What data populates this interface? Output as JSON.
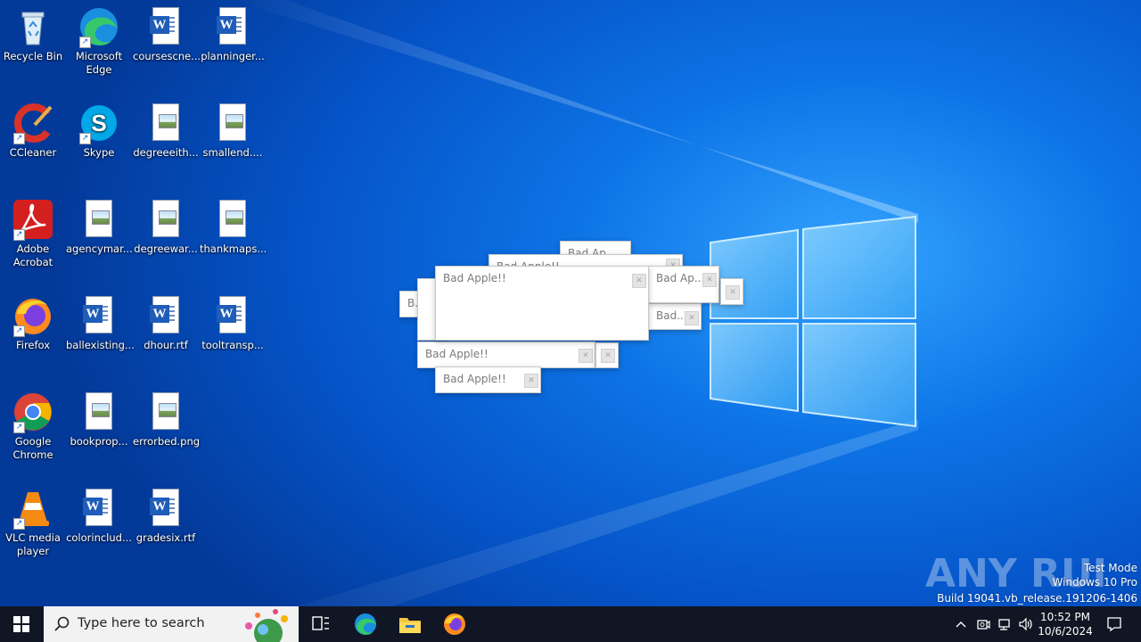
{
  "desktop": {
    "icons": [
      {
        "label": "Recycle Bin",
        "icon": "recycle-bin-icon"
      },
      {
        "label": "Microsoft Edge",
        "icon": "edge-icon"
      },
      {
        "label": "coursescne...",
        "icon": "word-doc-icon"
      },
      {
        "label": "planninger...",
        "icon": "word-doc-icon"
      },
      {
        "label": "CCleaner",
        "icon": "ccleaner-icon"
      },
      {
        "label": "Skype",
        "icon": "skype-icon"
      },
      {
        "label": "degreeeith...",
        "icon": "image-file-icon"
      },
      {
        "label": "smallend....",
        "icon": "image-file-icon"
      },
      {
        "label": "Adobe Acrobat",
        "icon": "acrobat-icon"
      },
      {
        "label": "agencymar...",
        "icon": "image-file-icon"
      },
      {
        "label": "degreewar...",
        "icon": "image-file-icon"
      },
      {
        "label": "thankmaps...",
        "icon": "image-file-icon"
      },
      {
        "label": "Firefox",
        "icon": "firefox-icon"
      },
      {
        "label": "ballexisting...",
        "icon": "word-doc-icon"
      },
      {
        "label": "dhour.rtf",
        "icon": "word-doc-icon"
      },
      {
        "label": "tooltransp...",
        "icon": "word-doc-icon"
      },
      {
        "label": "Google Chrome",
        "icon": "chrome-icon"
      },
      {
        "label": "bookprop...",
        "icon": "image-file-icon"
      },
      {
        "label": "errorbed.png",
        "icon": "image-file-icon"
      },
      {
        "label": "VLC media player",
        "icon": "vlc-icon"
      },
      {
        "label": "colorinclud...",
        "icon": "word-doc-icon"
      },
      {
        "label": "gradesix.rtf",
        "icon": "word-doc-icon"
      }
    ]
  },
  "dialogs": {
    "main_title": "Bad Apple!!",
    "d_top": "Bad Ap...",
    "d_back": "Bad Apple!!",
    "d_right": "Bad Ap...",
    "d_right2": "Bad...",
    "d_left": "B...",
    "d_low1": "Bad Apple!!",
    "d_low2": "Bad Apple!!"
  },
  "taskbar": {
    "search_placeholder": "Type here to search",
    "time": "10:52 PM",
    "date": "10/6/2024",
    "pinned": [
      "task-view-icon",
      "edge-icon",
      "file-explorer-icon",
      "firefox-icon"
    ]
  },
  "watermark": {
    "brand": "ANY RUN",
    "line1": "Test Mode",
    "line2": "Windows 10 Pro",
    "line3": "Build 19041.vb_release.191206-1406"
  },
  "colors": {
    "desktop_accent": "#0d74e6",
    "taskbar": "#101624"
  }
}
